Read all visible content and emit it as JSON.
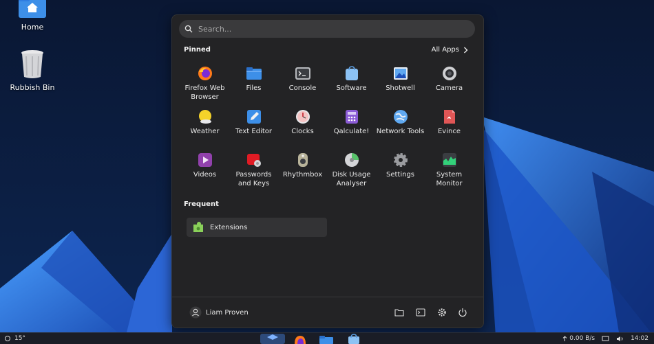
{
  "desktop": {
    "icons": [
      {
        "label": "Home",
        "icon": "home-folder-icon"
      },
      {
        "label": "Rubbish Bin",
        "icon": "trash-icon"
      }
    ]
  },
  "menu": {
    "search_placeholder": "Search...",
    "pinned_title": "Pinned",
    "all_apps_label": "All Apps",
    "pinned": [
      {
        "label": "Firefox Web Browser",
        "icon": "firefox-icon"
      },
      {
        "label": "Files",
        "icon": "files-icon"
      },
      {
        "label": "Console",
        "icon": "console-icon"
      },
      {
        "label": "Software",
        "icon": "software-icon"
      },
      {
        "label": "Shotwell",
        "icon": "shotwell-icon"
      },
      {
        "label": "Camera",
        "icon": "camera-icon"
      },
      {
        "label": "Weather",
        "icon": "weather-icon"
      },
      {
        "label": "Text Editor",
        "icon": "text-editor-icon"
      },
      {
        "label": "Clocks",
        "icon": "clocks-icon"
      },
      {
        "label": "Qalculate!",
        "icon": "calculator-icon"
      },
      {
        "label": "Network Tools",
        "icon": "network-tools-icon"
      },
      {
        "label": "Evince",
        "icon": "evince-icon"
      },
      {
        "label": "Videos",
        "icon": "videos-icon"
      },
      {
        "label": "Passwords and Keys",
        "icon": "passwords-icon"
      },
      {
        "label": "Rhythmbox",
        "icon": "rhythmbox-icon"
      },
      {
        "label": "Disk Usage Analyser",
        "icon": "disk-usage-icon"
      },
      {
        "label": "Settings",
        "icon": "settings-icon"
      },
      {
        "label": "System Monitor",
        "icon": "system-monitor-icon"
      }
    ],
    "frequent_title": "Frequent",
    "frequent": [
      {
        "label": "Extensions",
        "icon": "extensions-icon"
      }
    ],
    "footer": {
      "user_name": "Liam Proven",
      "buttons": [
        "folder-icon",
        "terminal-icon",
        "gear-icon",
        "power-icon"
      ]
    }
  },
  "taskbar": {
    "weather": "15°",
    "network_speed": "0.00 B/s",
    "clock": "14:02"
  },
  "colors": {
    "menu_bg": "#232325",
    "search_bg": "#3a3a3c",
    "accent_blue": "#2f7de1"
  }
}
